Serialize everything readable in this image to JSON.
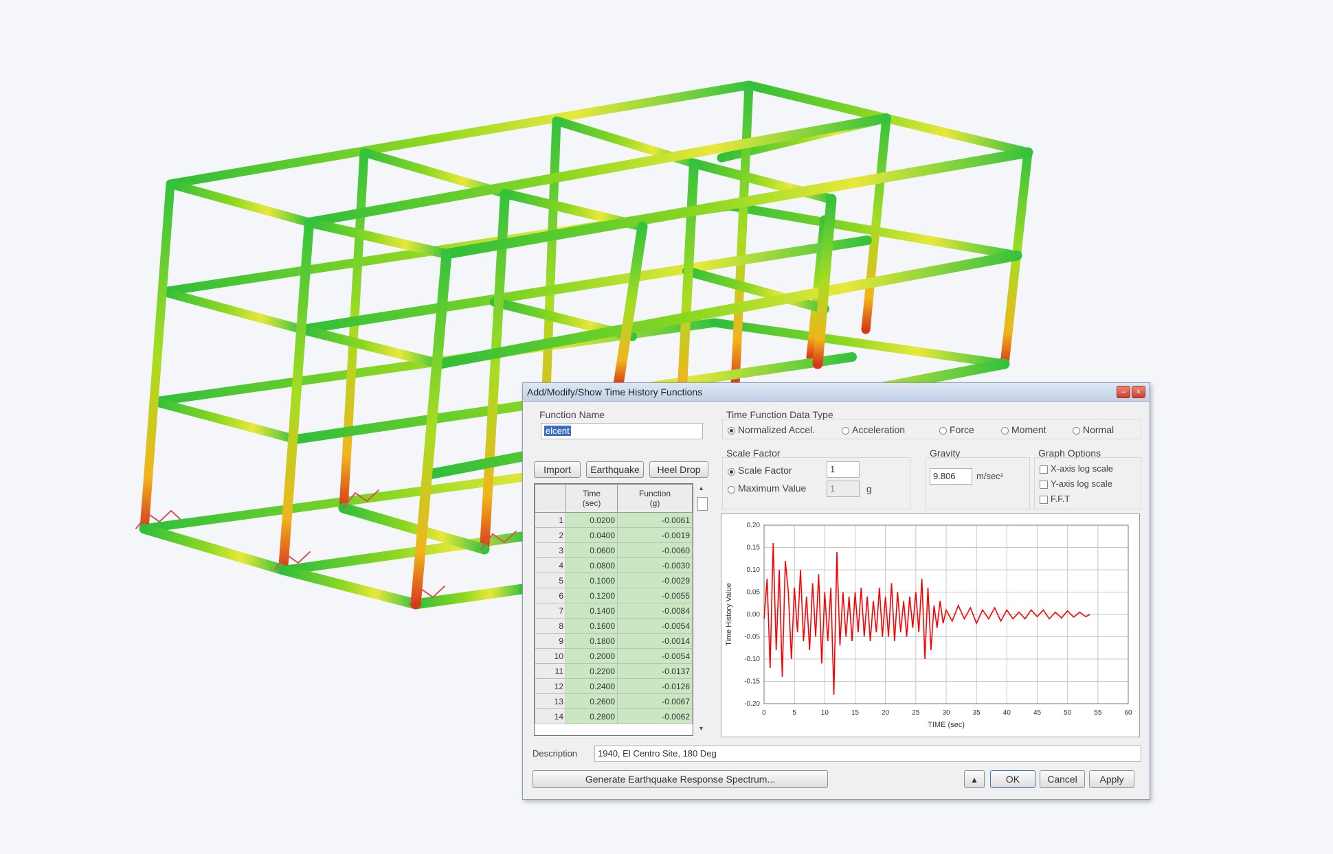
{
  "dialog": {
    "title": "Add/Modify/Show Time History Functions",
    "function_name_label": "Function Name",
    "function_name_value": "elcent",
    "buttons": {
      "import": "Import",
      "earthquake": "Earthquake",
      "heel_drop": "Heel Drop",
      "generate": "Generate Earthquake Response Spectrum...",
      "ok": "OK",
      "cancel": "Cancel",
      "apply": "Apply"
    },
    "data_type": {
      "label": "Time Function Data Type",
      "options": [
        "Normalized Accel.",
        "Acceleration",
        "Force",
        "Moment",
        "Normal"
      ],
      "selected": "Normalized Accel."
    },
    "scale_factor": {
      "label": "Scale Factor",
      "option_scale": "Scale Factor",
      "option_max": "Maximum Value",
      "scale_value": "1",
      "max_value": "1",
      "max_unit": "g"
    },
    "gravity": {
      "label": "Gravity",
      "value": "9.806",
      "unit": "m/sec²"
    },
    "graph_options": {
      "label": "Graph Options",
      "items": [
        "X-axis log scale",
        "Y-axis log scale",
        "F.F.T"
      ]
    },
    "table": {
      "col_time": "Time\n(sec)",
      "col_function": "Function\n(g)",
      "rows": [
        {
          "n": "1",
          "t": "0.0200",
          "f": "-0.0061"
        },
        {
          "n": "2",
          "t": "0.0400",
          "f": "-0.0019"
        },
        {
          "n": "3",
          "t": "0.0600",
          "f": "-0.0060"
        },
        {
          "n": "4",
          "t": "0.0800",
          "f": "-0.0030"
        },
        {
          "n": "5",
          "t": "0.1000",
          "f": "-0.0029"
        },
        {
          "n": "6",
          "t": "0.1200",
          "f": "-0.0055"
        },
        {
          "n": "7",
          "t": "0.1400",
          "f": "-0.0084"
        },
        {
          "n": "8",
          "t": "0.1600",
          "f": "-0.0054"
        },
        {
          "n": "9",
          "t": "0.1800",
          "f": "-0.0014"
        },
        {
          "n": "10",
          "t": "0.2000",
          "f": "-0.0054"
        },
        {
          "n": "11",
          "t": "0.2200",
          "f": "-0.0137"
        },
        {
          "n": "12",
          "t": "0.2400",
          "f": "-0.0126"
        },
        {
          "n": "13",
          "t": "0.2600",
          "f": "-0.0067"
        },
        {
          "n": "14",
          "t": "0.2800",
          "f": "-0.0062"
        }
      ]
    },
    "description_label": "Description",
    "description_value": "1940, El Centro Site, 180 Deg"
  },
  "chart_data": {
    "type": "line",
    "title": "",
    "xlabel": "TIME (sec)",
    "ylabel": "Time History Value",
    "xlim": [
      0,
      60
    ],
    "ylim": [
      -0.2,
      0.2
    ],
    "xticks": [
      "0",
      "5",
      "10",
      "15",
      "20",
      "25",
      "30",
      "35",
      "40",
      "45",
      "50",
      "55",
      "60"
    ],
    "yticks": [
      "0.20",
      "0.15",
      "0.10",
      "0.05",
      "0.00",
      "-0.05",
      "-0.10",
      "-0.15",
      "-0.20"
    ],
    "series": [
      {
        "color": "#ff0000",
        "x": [
          0,
          0.5,
          1,
          1.5,
          2,
          2.5,
          3,
          3.5,
          4,
          4.5,
          5,
          5.5,
          6,
          6.5,
          7,
          7.5,
          8,
          8.5,
          9,
          9.5,
          10,
          10.5,
          11,
          11.5,
          12,
          12.5,
          13,
          13.5,
          14,
          14.5,
          15,
          15.5,
          16,
          16.5,
          17,
          17.5,
          18,
          18.5,
          19,
          19.5,
          20,
          20.5,
          21,
          21.5,
          22,
          22.5,
          23,
          23.5,
          24,
          24.5,
          25,
          25.5,
          26,
          26.5,
          27,
          27.5,
          28,
          28.5,
          29,
          29.5,
          30,
          31,
          32,
          33,
          34,
          35,
          36,
          37,
          38,
          39,
          40,
          41,
          42,
          43,
          44,
          45,
          46,
          47,
          48,
          49,
          50,
          51,
          52,
          53,
          53.7
        ],
        "y": [
          -0.01,
          0.08,
          -0.12,
          0.16,
          -0.08,
          0.1,
          -0.14,
          0.12,
          0.05,
          -0.1,
          0.06,
          -0.04,
          0.1,
          -0.06,
          0.04,
          -0.08,
          0.07,
          -0.05,
          0.09,
          -0.11,
          0.05,
          -0.06,
          0.06,
          -0.18,
          0.14,
          -0.07,
          0.05,
          -0.05,
          0.04,
          -0.06,
          0.05,
          -0.04,
          0.06,
          -0.05,
          0.04,
          -0.06,
          0.03,
          -0.04,
          0.06,
          -0.05,
          0.04,
          -0.05,
          0.07,
          -0.06,
          0.05,
          -0.04,
          0.03,
          -0.05,
          0.04,
          -0.03,
          0.05,
          -0.04,
          0.08,
          -0.1,
          0.06,
          -0.08,
          0.02,
          -0.03,
          0.03,
          -0.02,
          0.01,
          -0.015,
          0.02,
          -0.01,
          0.015,
          -0.02,
          0.01,
          -0.01,
          0.015,
          -0.015,
          0.01,
          -0.01,
          0.005,
          -0.01,
          0.01,
          -0.005,
          0.01,
          -0.01,
          0.005,
          -0.008,
          0.008,
          -0.006,
          0.005,
          -0.005,
          0.0
        ]
      }
    ]
  }
}
